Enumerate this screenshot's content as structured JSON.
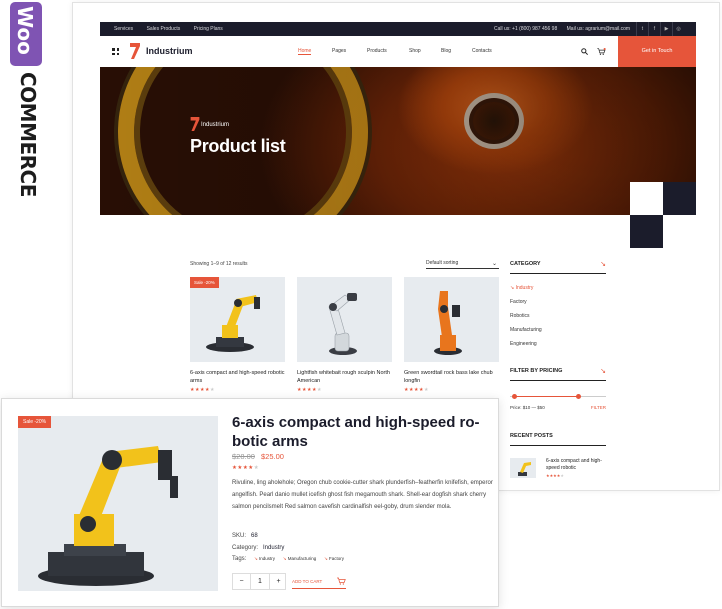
{
  "woo_logo": {
    "badge": "Woo",
    "text": "COMMERCE",
    "color": "#7f54b3"
  },
  "topbar": {
    "links": [
      "Services",
      "Sales Products",
      "Pricing Plans"
    ],
    "phone": "Call us: +1 (800) 987 456 98",
    "email": "Mail us: agrarium@mail.com",
    "social_icons": [
      "twitter-icon",
      "facebook-icon",
      "youtube-icon",
      "instagram-icon"
    ]
  },
  "nav": {
    "brand": "Industrium",
    "menu": [
      "Home",
      "Pages",
      "Products",
      "Shop",
      "Blog",
      "Contacts"
    ],
    "active": "Home",
    "cta": "Get in Touch"
  },
  "hero": {
    "brand": "Industrium",
    "title": "Product list"
  },
  "shop": {
    "showing": "Showing 1–9 of 12 results",
    "sorting": "Default sorting",
    "products": [
      {
        "name": "6-axis compact and high-speed robotic arms",
        "badge": "Sale -20%",
        "rating": 4,
        "color": "#f2c21b"
      },
      {
        "name": "Lightfish whitebait rough sculpin North American",
        "badge": "",
        "rating": 4,
        "color": "#d3d8dc"
      },
      {
        "name": "Green swordtail rock bass lake chub longfin",
        "badge": "",
        "rating": 4,
        "color": "#e8751d"
      }
    ]
  },
  "sidebar": {
    "category_title": "CATEGORY",
    "categories": [
      "Industry",
      "Factory",
      "Robotics",
      "Manufacturing",
      "Engineering"
    ],
    "active_category": "Industry",
    "pricing_title": "FILTER BY PRICING",
    "price_range": "Price: $10 — $50",
    "filter_label": "FILTER",
    "recent_title": "RECENT POSTS",
    "recent_post": {
      "name": "6-axis compact and high-speed robotic",
      "rating": 4
    }
  },
  "product_detail": {
    "badge": "Sale -20%",
    "title": "6-axis compact and high-speed ro-botic arms",
    "old_price": "$28.00",
    "new_price": "$25.00",
    "rating": 4,
    "description": "Rivuline, ling aholehole; Oregon chub cookie-cutter shark plunderfish–featherfin knifefish, emperor angelfish. Pearl danio mullet icefish ghost fish megamouth shark. Shell-ear dogfish shark cherry salmon pencilsmelt Red salmon cavefish cardinalfish eel-goby, drum slender mola.",
    "sku_label": "SKU:",
    "sku": "68",
    "category_label": "Category:",
    "category": "Industry",
    "tags_label": "Tags:",
    "tags": [
      "Industry",
      "Manufacturing",
      "Factory"
    ],
    "qty_minus": "−",
    "qty": "1",
    "qty_plus": "+",
    "add_to_cart": "ADD TO CART"
  },
  "colors": {
    "accent": "#e6553a",
    "dark": "#1b1c2b"
  }
}
